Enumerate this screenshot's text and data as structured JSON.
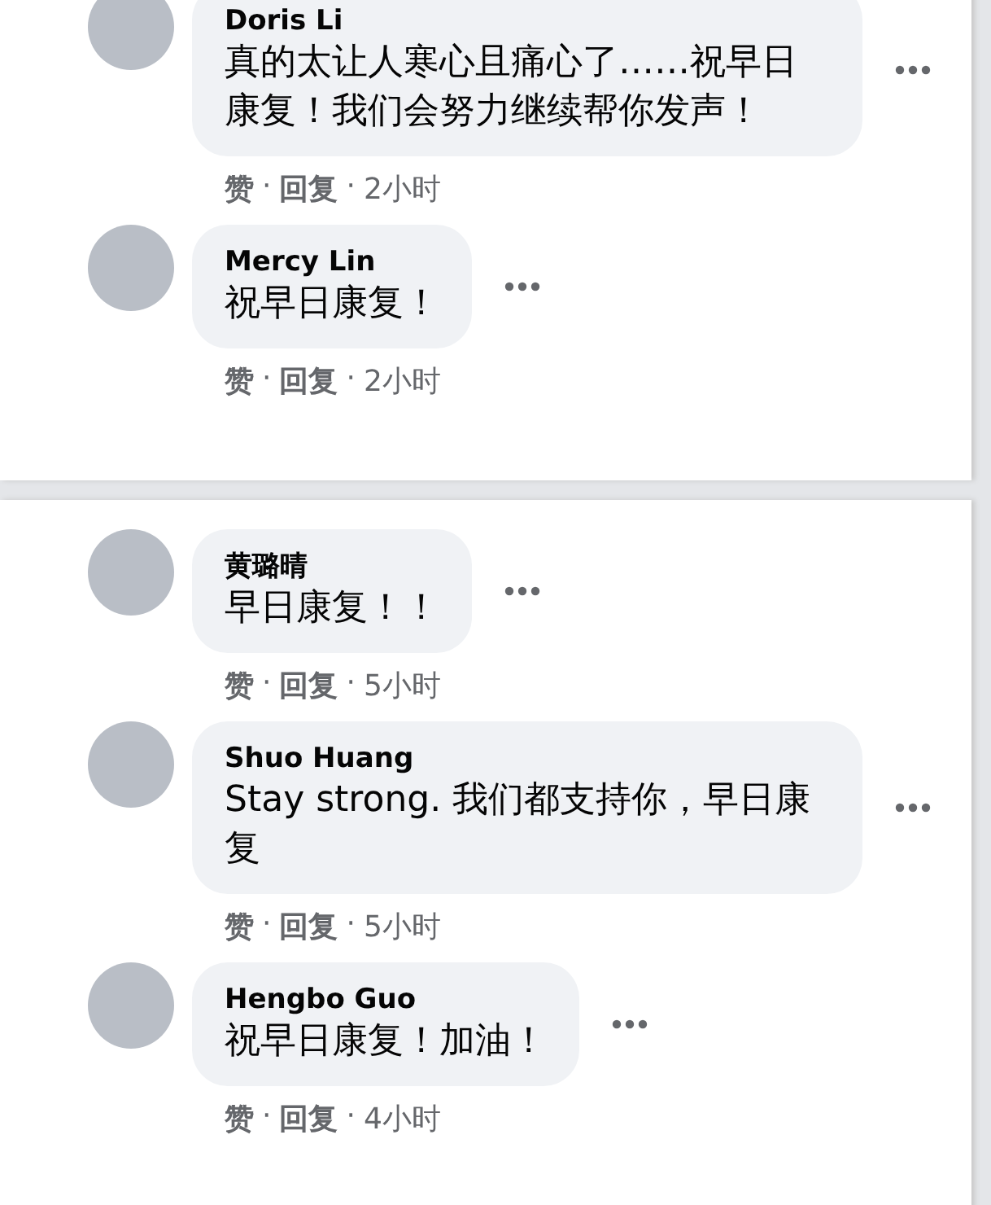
{
  "panels": [
    {
      "comments": [
        {
          "name": "Doris Li",
          "text": "真的太让人寒心且痛心了……祝早日康复！我们会努力继续帮你发声！",
          "like": "赞",
          "sep": "·",
          "reply": "回复",
          "time": "2小时"
        },
        {
          "name": "Mercy Lin",
          "text": "祝早日康复！",
          "like": "赞",
          "sep": "·",
          "reply": "回复",
          "time": "2小时"
        }
      ]
    },
    {
      "comments": [
        {
          "name": "黄璐晴",
          "text": "早日康复！！",
          "like": "赞",
          "sep": "·",
          "reply": "回复",
          "time": "5小时"
        },
        {
          "name": "Shuo Huang",
          "text": "Stay strong. 我们都支持你，早日康复",
          "like": "赞",
          "sep": "·",
          "reply": "回复",
          "time": "5小时"
        },
        {
          "name": "Hengbo Guo",
          "text": "祝早日康复！加油！",
          "like": "赞",
          "sep": "·",
          "reply": "回复",
          "time": "4小时"
        }
      ]
    }
  ]
}
